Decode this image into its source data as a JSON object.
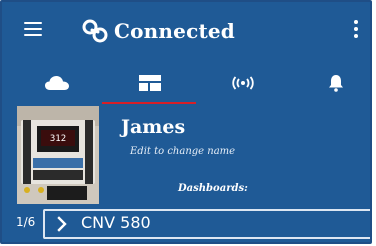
{
  "app": {
    "title": "Connected",
    "icons": {
      "menu": "hamburger-menu-icon",
      "logo": "link-icon",
      "more": "more-vert-icon"
    }
  },
  "tabs": [
    {
      "icon": "cloud-icon",
      "selected": false
    },
    {
      "icon": "dashboard-icon",
      "selected": true
    },
    {
      "icon": "broadcast-icon",
      "selected": false
    },
    {
      "icon": "bell-icon",
      "selected": false
    }
  ],
  "device": {
    "name": "James",
    "edit_hint": "Edit to change name",
    "display_value": "312",
    "dashboards_label": "Dashboards:"
  },
  "dashboard": {
    "counter": "1/6",
    "name": "CNV 580"
  },
  "colors": {
    "primary": "#1f5a96",
    "accent": "#d81f27",
    "text": "#ffffff"
  }
}
